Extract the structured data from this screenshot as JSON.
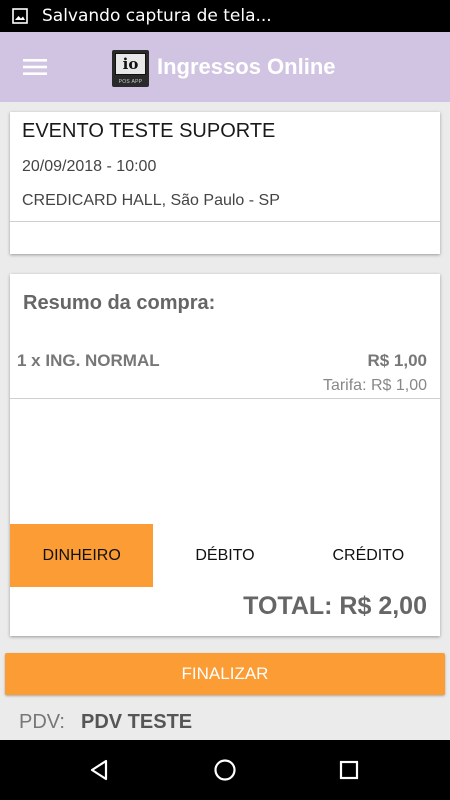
{
  "status_bar": {
    "notification_icon": "image-icon",
    "text": "Salvando captura de tela..."
  },
  "app_bar": {
    "menu_icon": "hamburger-menu-icon",
    "logo_text": "io",
    "logo_subtext": "POS APP",
    "title": "Ingressos Online"
  },
  "event": {
    "name": "EVENTO TESTE SUPORTE",
    "date": "20/09/2018 - 10:00",
    "venue": "CREDICARD HALL, São Paulo - SP"
  },
  "summary": {
    "title": "Resumo da compra:",
    "items": [
      {
        "name": "1 x ING. NORMAL",
        "price": "R$ 1,00",
        "fee": "Tarifa: R$ 1,00"
      }
    ],
    "payment_methods": [
      {
        "label": "DINHEIRO",
        "selected": true
      },
      {
        "label": "DÉBITO",
        "selected": false
      },
      {
        "label": "CRÉDITO",
        "selected": false
      }
    ],
    "total": "TOTAL: R$ 2,00"
  },
  "finalize_label": "FINALIZAR",
  "pdv": {
    "label": "PDV:",
    "value": "PDV TESTE"
  },
  "nav": {
    "back_icon": "back-triangle-icon",
    "home_icon": "home-circle-icon",
    "recents_icon": "recents-square-icon"
  },
  "colors": {
    "accent": "#fb9c34",
    "app_bar": "#d1c4e2",
    "background": "#ebebeb"
  }
}
